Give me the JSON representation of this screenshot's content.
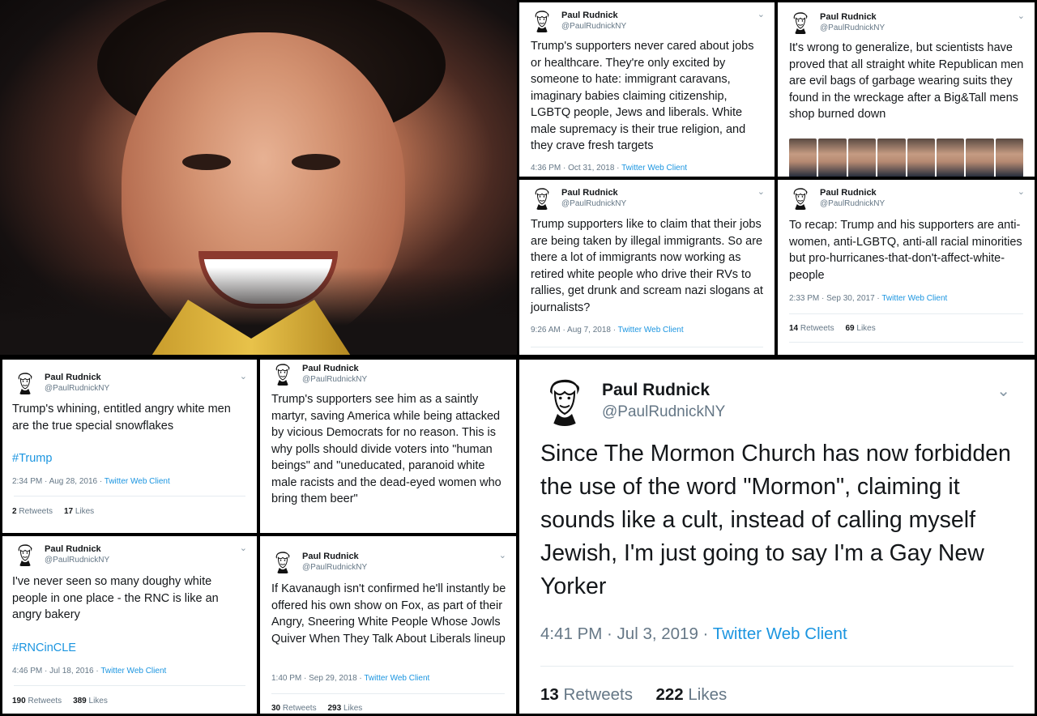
{
  "author": {
    "name": "Paul Rudnick",
    "handle": "@PaulRudnickNY"
  },
  "tweets": {
    "t1": {
      "text": "Trump's supporters never cared about jobs or healthcare. They're only excited by someone to hate: immigrant caravans, imaginary babies claiming citizenship, LGBTQ people, Jews and liberals. White male supremacy is their true religion, and they crave fresh targets",
      "time": "4:36 PM · Oct 31, 2018 · ",
      "client": "Twitter Web Client"
    },
    "t2": {
      "text": "It's wrong to generalize, but scientists have proved that all straight white Republican men are evil bags of garbage wearing suits they found in the wreckage after a Big&Tall mens shop burned down"
    },
    "t3": {
      "text": "Trump supporters like to claim that their jobs are being taken by illegal immigrants. So are there a lot of immigrants now working as retired white people who drive their RVs to rallies, get drunk and scream nazi slogans at journalists?",
      "time": "9:26 AM · Aug 7, 2018 · ",
      "client": "Twitter Web Client"
    },
    "t4": {
      "text": "To recap: Trump and his supporters are anti-women, anti-LGBTQ, anti-all racial minorities but pro-hurricanes-that-don't-affect-white-people",
      "time": "2:33 PM · Sep 30, 2017 · ",
      "client": "Twitter Web Client",
      "retweets": "14",
      "retweets_label": " Retweets",
      "likes": "69",
      "likes_label": " Likes"
    },
    "t5": {
      "text": "Trump's whining, entitled angry white men are the true special snowflakes",
      "hashtag": "#Trump",
      "time": "2:34 PM · Aug 28, 2016 · ",
      "client": "Twitter Web Client",
      "retweets": "2",
      "retweets_label": " Retweets",
      "likes": "17",
      "likes_label": " Likes"
    },
    "t6": {
      "text": "Trump's supporters see him as a saintly martyr, saving America while being attacked by vicious Democrats for no reason. This is why polls should divide voters into \"human beings\" and \"uneducated, paranoid white male racists and the dead-eyed women who bring them beer\""
    },
    "t7": {
      "text": "I've never seen so many doughy white people in one place - the RNC is like an angry bakery",
      "hashtag": "#RNCinCLE",
      "time": "4:46 PM · Jul 18, 2016 · ",
      "client": "Twitter Web Client",
      "retweets": "190",
      "retweets_label": " Retweets",
      "likes": "389",
      "likes_label": " Likes"
    },
    "t8": {
      "text": "If Kavanaugh isn't confirmed he'll instantly be offered his own show on Fox, as part of their Angry, Sneering White People Whose Jowls Quiver When They Talk About Liberals lineup",
      "time": "1:40 PM · Sep 29, 2018 · ",
      "client": "Twitter Web Client",
      "retweets": "30",
      "retweets_label": " Retweets",
      "likes": "293",
      "likes_label": " Likes"
    },
    "t9": {
      "text": "Since The Mormon Church has now forbidden the use of the word \"Mormon\", claiming it sounds like a cult, instead of calling myself Jewish, I'm just going to say I'm a Gay New Yorker",
      "time": "4:41 PM · Jul 3, 2019 · ",
      "client": "Twitter Web Client",
      "retweets": "13",
      "retweets_label": " Retweets",
      "likes": "222",
      "likes_label": " Likes"
    }
  },
  "colors": {
    "link": "#1b95e0",
    "muted": "#657786",
    "text": "#14171a",
    "divider": "#e6ecf0"
  },
  "icons": {
    "menu": "chevron-down-icon",
    "avatar": "caricature-avatar"
  }
}
